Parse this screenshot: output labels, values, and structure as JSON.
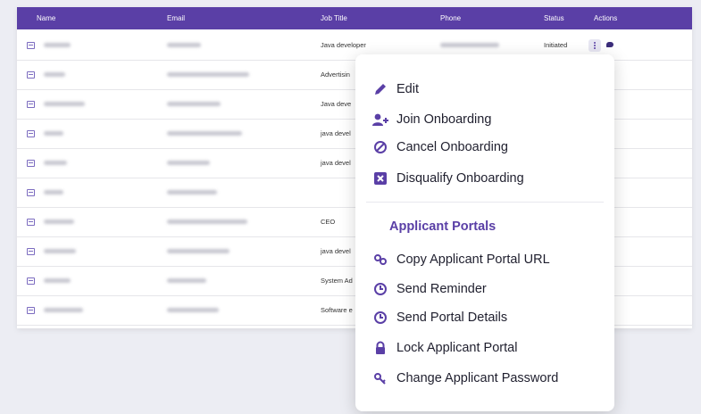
{
  "table": {
    "headers": [
      "Name",
      "Email",
      "Job Title",
      "Phone",
      "Status",
      "Actions"
    ],
    "rows": [
      {
        "job": "Java developer",
        "status": "Initiated"
      },
      {
        "job": "Advertisin",
        "status": ""
      },
      {
        "job": "Java deve",
        "status": ""
      },
      {
        "job": "java devel",
        "status": ""
      },
      {
        "job": "java devel",
        "status": ""
      },
      {
        "job": "",
        "status": ""
      },
      {
        "job": "CEO",
        "status": ""
      },
      {
        "job": "java devel",
        "status": ""
      },
      {
        "job": "System Ad",
        "status": ""
      },
      {
        "job": "Software e",
        "status": ""
      }
    ]
  },
  "menu": {
    "items": [
      {
        "label": "Edit",
        "icon": "pencil-icon"
      },
      {
        "label": "Join Onboarding",
        "icon": "user-plus-icon"
      },
      {
        "label": "Cancel Onboarding",
        "icon": "cancel-icon"
      },
      {
        "label": "Disqualify Onboarding",
        "icon": "x-box-icon"
      }
    ],
    "section_title": "Applicant Portals",
    "portal_items": [
      {
        "label": "Copy Applicant Portal URL",
        "icon": "link-icon"
      },
      {
        "label": "Send Reminder",
        "icon": "clock-icon"
      },
      {
        "label": "Send Portal Details",
        "icon": "clock-icon"
      },
      {
        "label": "Lock Applicant Portal",
        "icon": "lock-icon"
      },
      {
        "label": "Change Applicant Password",
        "icon": "key-icon"
      }
    ]
  },
  "colors": {
    "accent": "#5a3fa6",
    "header": "#5a3fa6",
    "background": "#ecedf3"
  }
}
